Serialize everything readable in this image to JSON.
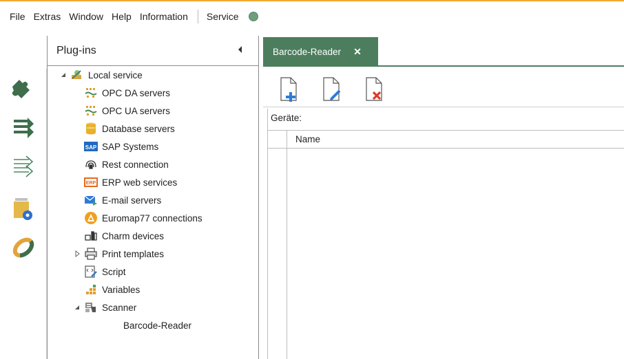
{
  "menubar": {
    "items": [
      "File",
      "Extras",
      "Window",
      "Help",
      "Information"
    ],
    "service_label": "Service",
    "service_status_color": "#6e9e7c"
  },
  "iconbar": {
    "items": [
      {
        "name": "plugins-puzzle-icon",
        "active": true
      },
      {
        "name": "flow-filled-icon",
        "active": false
      },
      {
        "name": "flow-outline-icon",
        "active": false
      },
      {
        "name": "folder-settings-icon",
        "active": false
      },
      {
        "name": "connection-ring-icon",
        "active": false
      }
    ]
  },
  "plugins_panel": {
    "title": "Plug-ins",
    "tree": {
      "root": {
        "label": "Local service",
        "icon": "local-service-icon",
        "expanded": true
      },
      "children": [
        {
          "label": "OPC DA servers",
          "icon": "opc-da-icon"
        },
        {
          "label": "OPC UA servers",
          "icon": "opc-ua-icon"
        },
        {
          "label": "Database servers",
          "icon": "database-icon"
        },
        {
          "label": "SAP Systems",
          "icon": "sap-icon",
          "icon_text": "SAP"
        },
        {
          "label": "Rest connection",
          "icon": "rest-icon"
        },
        {
          "label": "ERP web services",
          "icon": "erp-icon",
          "icon_text": "ERP"
        },
        {
          "label": "E-mail servers",
          "icon": "email-icon"
        },
        {
          "label": "Euromap77 connections",
          "icon": "euromap-icon"
        },
        {
          "label": "Charm devices",
          "icon": "charm-icon"
        },
        {
          "label": "Print templates",
          "icon": "printer-icon",
          "collapsed": true
        },
        {
          "label": "Script",
          "icon": "script-icon"
        },
        {
          "label": "Variables",
          "icon": "variables-icon"
        },
        {
          "label": "Scanner",
          "icon": "scanner-icon",
          "expanded": true
        }
      ],
      "scanner_children": [
        {
          "label": "Barcode-Reader"
        }
      ]
    }
  },
  "document": {
    "tab_label": "Barcode-Reader",
    "tab_close": "✕",
    "accent_color": "#4c7e5d",
    "toolbar": [
      "add-document-icon",
      "edit-document-icon",
      "delete-document-icon"
    ],
    "section_label": "Geräte:",
    "grid": {
      "columns": [
        "Name"
      ],
      "rows": []
    }
  }
}
